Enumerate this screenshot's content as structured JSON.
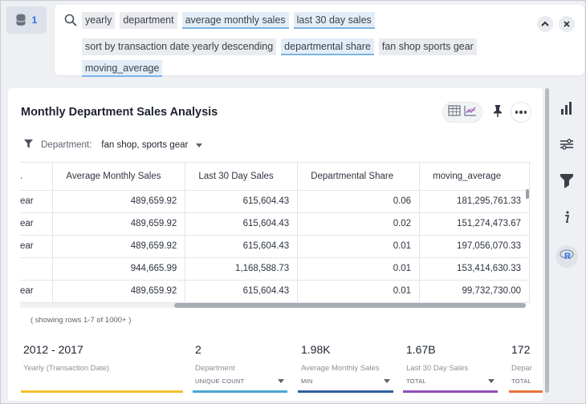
{
  "source": {
    "count": "1",
    "icon": "database-icon"
  },
  "search": {
    "tokens_row1": [
      {
        "label": "yearly",
        "kind": "plain"
      },
      {
        "label": "department",
        "kind": "plain"
      },
      {
        "label": "average monthly sales",
        "kind": "metric"
      },
      {
        "label": "last 30 day sales",
        "kind": "metric"
      }
    ],
    "tokens_row2": [
      {
        "label": "sort by transaction date yearly descending",
        "kind": "plain"
      },
      {
        "label": "departmental share",
        "kind": "metric"
      },
      {
        "label": "fan shop sports gear",
        "kind": "plain"
      },
      {
        "label": "moving_average",
        "kind": "metric"
      }
    ]
  },
  "panel": {
    "title": "Monthly Department Sales Analysis",
    "filter_label": "Department:",
    "filter_value": "fan shop, sports gear",
    "row_count": "( showing rows 1-7 of 1000+ )"
  },
  "table": {
    "columns": [
      ".",
      "Average Monthly Sales",
      "Last 30 Day Sales",
      "Departmental Share",
      "moving_average"
    ],
    "rows": [
      [
        "ear",
        "489,659.92",
        "615,604.43",
        "0.06",
        "181,295,761.33"
      ],
      [
        "ear",
        "489,659.92",
        "615,604.43",
        "0.02",
        "151,274,473.67"
      ],
      [
        "ear",
        "489,659.92",
        "615,604.43",
        "0.01",
        "197,056,070.33"
      ],
      [
        "",
        "944,665.99",
        "1,168,588.73",
        "0.01",
        "153,414,630.33"
      ],
      [
        "ear",
        "489,659.92",
        "615,604.43",
        "0.01",
        "99,732,730.00"
      ]
    ]
  },
  "kpis": [
    {
      "value": "2012   -   2017",
      "label": "Yearly (Transaction Date)",
      "agg": "",
      "color": "#f2c12e"
    },
    {
      "value": "2",
      "label": "Department",
      "agg": "UNIQUE COUNT",
      "color": "#4aa7d6"
    },
    {
      "value": "1.98K",
      "label": "Average Monthly Sales",
      "agg": "MIN",
      "color": "#2d5f9e"
    },
    {
      "value": "1.67B",
      "label": "Last 30 Day Sales",
      "agg": "TOTAL",
      "color": "#8e4fb8"
    },
    {
      "value": "172",
      "label": "Depar",
      "agg": "TOTAL",
      "color": "#e8743b"
    }
  ],
  "rail": [
    "bar-chart-icon",
    "settings-sliders-icon",
    "spotlight-icon",
    "info-icon",
    "r-icon"
  ]
}
